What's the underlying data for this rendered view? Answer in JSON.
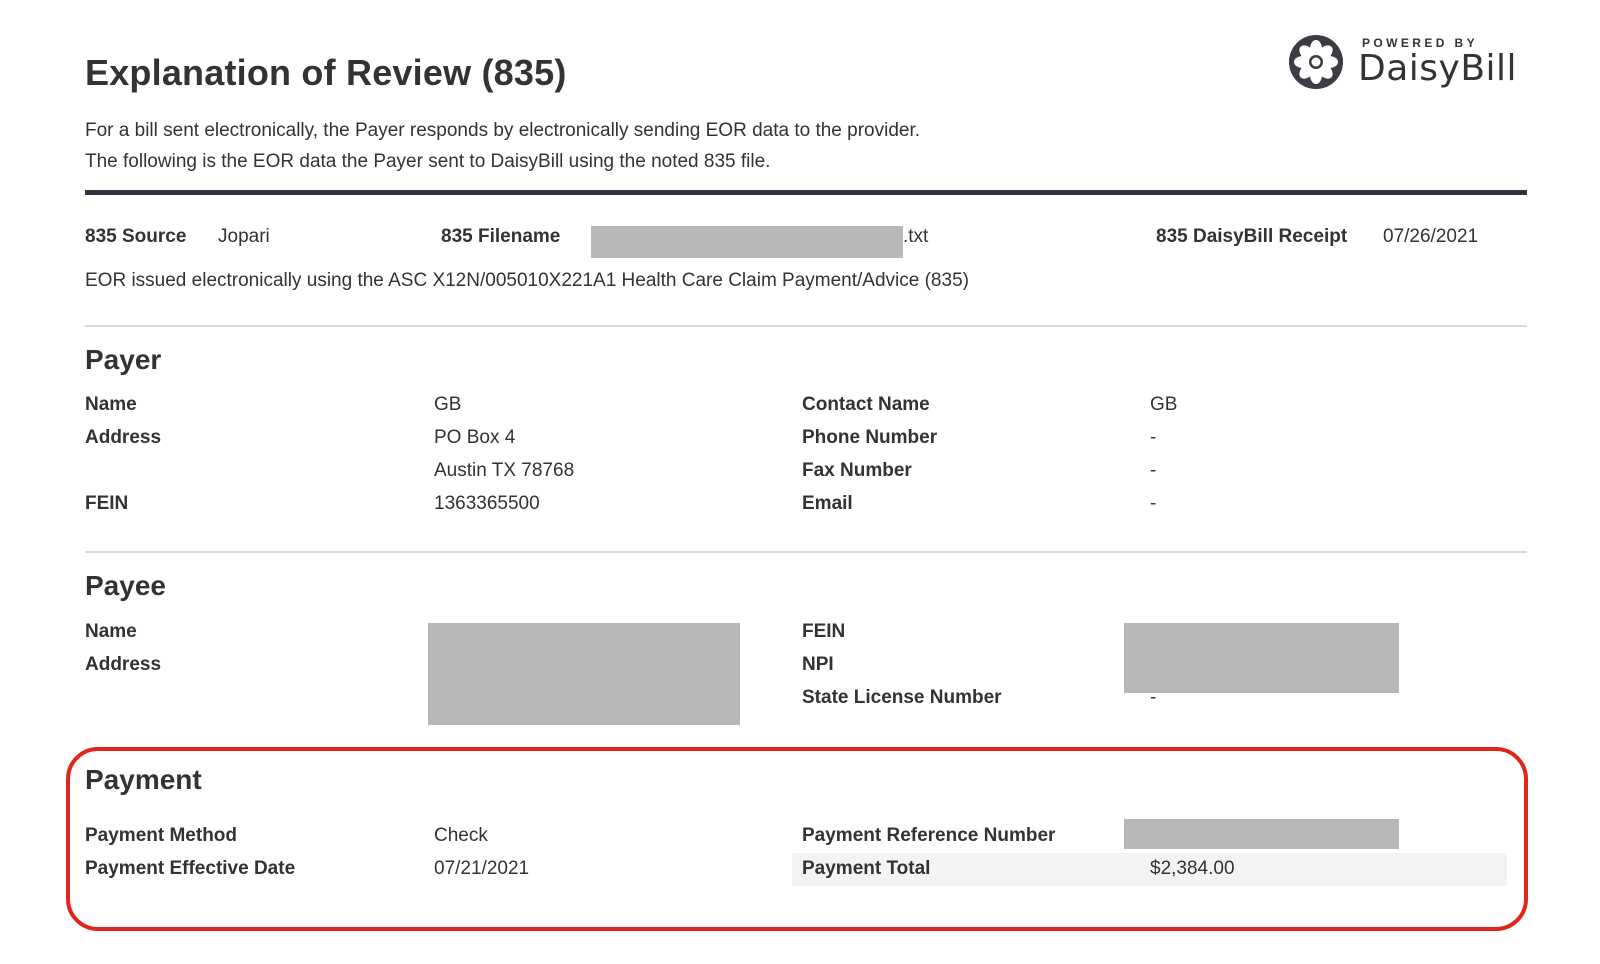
{
  "header": {
    "title": "Explanation of Review (835)",
    "intro_line1": "For a bill sent electronically, the Payer responds by electronically sending EOR data to the provider.",
    "intro_line2": "The following is the EOR data the Payer sent to DaisyBill using the noted 835 file.",
    "logo_small": "POWERED BY",
    "logo_name": "DaisyBill",
    "logo_icon": "daisy-flower-icon"
  },
  "meta": {
    "source_label": "835 Source",
    "source_value": "Jopari",
    "filename_label": "835 Filename",
    "filename_suffix": ".txt",
    "receipt_label": "835 DaisyBill Receipt",
    "receipt_value": "07/26/2021",
    "note": "EOR issued electronically using the ASC X12N/005010X221A1 Health Care Claim Payment/Advice (835)"
  },
  "payer": {
    "heading": "Payer",
    "name_label": "Name",
    "name_value": "GB",
    "address_label": "Address",
    "address_line1": "PO Box 4",
    "address_line2": "Austin TX 78768",
    "fein_label": "FEIN",
    "fein_value": "1363365500",
    "contact_label": "Contact Name",
    "contact_value": "GB",
    "phone_label": "Phone Number",
    "phone_value": "-",
    "fax_label": "Fax Number",
    "fax_value": "-",
    "email_label": "Email",
    "email_value": "-"
  },
  "payee": {
    "heading": "Payee",
    "name_label": "Name",
    "address_label": "Address",
    "fein_label": "FEIN",
    "npi_label": "NPI",
    "license_label": "State License Number",
    "license_value": "-"
  },
  "payment": {
    "heading": "Payment",
    "method_label": "Payment Method",
    "method_value": "Check",
    "effective_label": "Payment Effective Date",
    "effective_value": "07/21/2021",
    "reference_label": "Payment Reference Number",
    "total_label": "Payment Total",
    "total_value": "$2,384.00"
  },
  "colors": {
    "highlight": "#e1251b",
    "rule": "#2e3440",
    "redaction": "#b7b7b7"
  }
}
